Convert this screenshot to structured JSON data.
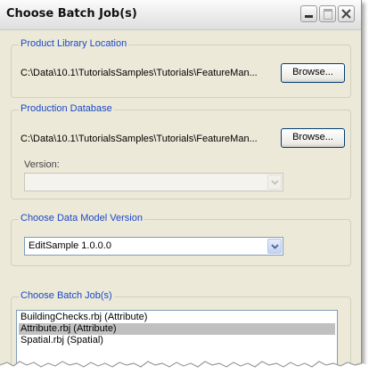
{
  "window": {
    "title": "Choose Batch Job(s)",
    "controls": [
      "minimize-icon",
      "maximize-icon",
      "close-icon"
    ]
  },
  "product_library": {
    "legend": "Product Library Location",
    "path": "C:\\Data\\10.1\\TutorialsSamples\\Tutorials\\FeatureMan...",
    "browse_label": "Browse..."
  },
  "production_database": {
    "legend": "Production Database",
    "path": "C:\\Data\\10.1\\TutorialsSamples\\Tutorials\\FeatureMan...",
    "browse_label": "Browse...",
    "version_label": "Version:",
    "version_value": ""
  },
  "data_model": {
    "legend": "Choose Data Model Version",
    "selected": "EditSample 1.0.0.0"
  },
  "batch_jobs": {
    "legend": "Choose Batch Job(s)",
    "items": [
      {
        "label": "BuildingChecks.rbj (Attribute)",
        "selected": false
      },
      {
        "label": "Attribute.rbj (Attribute)",
        "selected": true
      },
      {
        "label": "Spatial.rbj (Spatial)",
        "selected": false
      }
    ]
  },
  "colors": {
    "legend_text": "#1a48c8",
    "dialog_bg": "#ece9d8",
    "selection": "#c0c0c0"
  }
}
